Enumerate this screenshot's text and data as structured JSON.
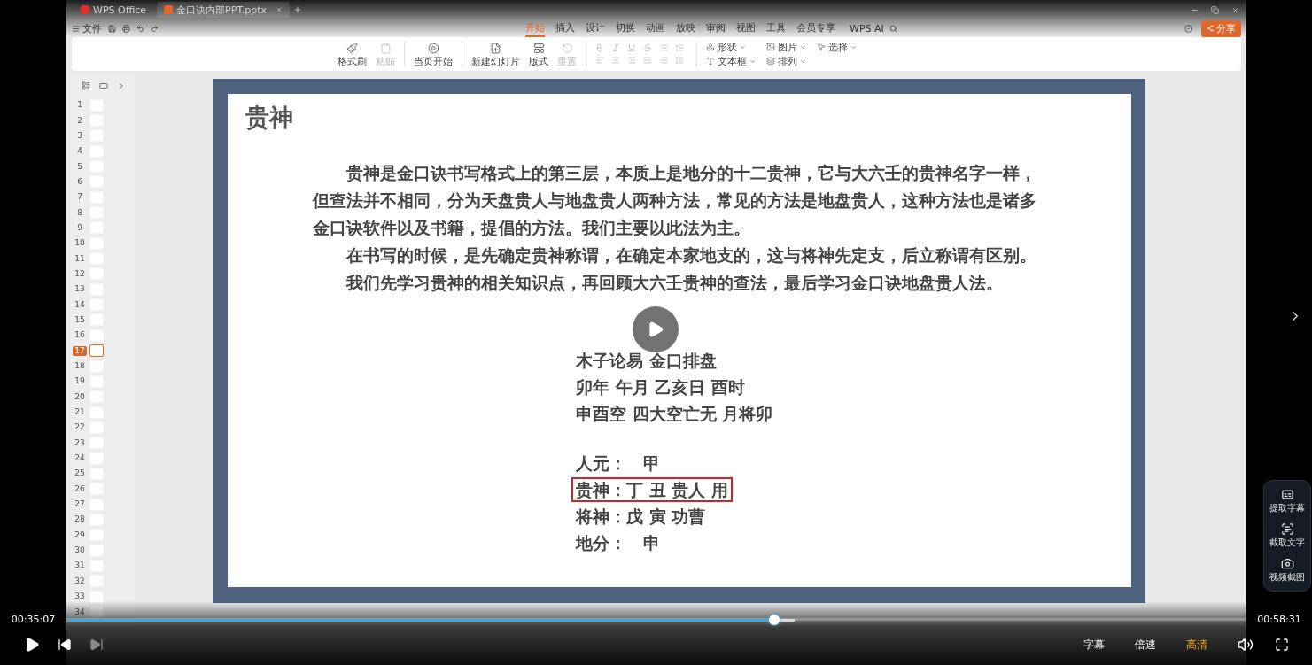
{
  "app_tabs": [
    {
      "label": "WPS Office",
      "kind": "home",
      "selected": false
    },
    {
      "label": "金口诀内部PPT.pptx",
      "kind": "doc",
      "selected": true
    }
  ],
  "menu": {
    "file": "文件",
    "tabs": [
      {
        "label": "开始",
        "selected": true
      },
      {
        "label": "插入",
        "selected": false
      },
      {
        "label": "设计",
        "selected": false
      },
      {
        "label": "切换",
        "selected": false
      },
      {
        "label": "动画",
        "selected": false
      },
      {
        "label": "放映",
        "selected": false
      },
      {
        "label": "审阅",
        "selected": false
      },
      {
        "label": "视图",
        "selected": false
      },
      {
        "label": "工具",
        "selected": false
      },
      {
        "label": "会员专享",
        "selected": false
      }
    ],
    "ai": "WPS AI",
    "share": "分享"
  },
  "ribbon": {
    "large": [
      {
        "label": "格式刷",
        "kind": "brush",
        "disabled": false
      },
      {
        "label": "粘贴",
        "kind": "paste",
        "disabled": true
      },
      {
        "label": "当页开始",
        "kind": "play",
        "disabled": false
      },
      {
        "label": "新建幻灯片",
        "kind": "new-slide",
        "disabled": false
      },
      {
        "label": "版式",
        "kind": "layout",
        "disabled": false
      },
      {
        "label": "重置",
        "kind": "reset",
        "disabled": true
      }
    ],
    "small": [
      {
        "label": "形状",
        "kind": "shapes"
      },
      {
        "label": "文本框",
        "kind": "textbox"
      },
      {
        "label": "图片",
        "kind": "image"
      },
      {
        "label": "排列",
        "kind": "arrange"
      },
      {
        "label": "选择",
        "kind": "select"
      }
    ]
  },
  "slides": [
    {
      "number": "1",
      "selected": false
    },
    {
      "number": "2",
      "selected": false
    },
    {
      "number": "3",
      "selected": false
    },
    {
      "number": "4",
      "selected": false
    },
    {
      "number": "5",
      "selected": false
    },
    {
      "number": "6",
      "selected": false
    },
    {
      "number": "7",
      "selected": false
    },
    {
      "number": "8",
      "selected": false
    },
    {
      "number": "9",
      "selected": false
    },
    {
      "number": "10",
      "selected": false
    },
    {
      "number": "11",
      "selected": false
    },
    {
      "number": "12",
      "selected": false
    },
    {
      "number": "13",
      "selected": false
    },
    {
      "number": "14",
      "selected": false
    },
    {
      "number": "15",
      "selected": false
    },
    {
      "number": "16",
      "selected": false
    },
    {
      "number": "17",
      "selected": true
    },
    {
      "number": "18",
      "selected": false
    },
    {
      "number": "19",
      "selected": false
    },
    {
      "number": "20",
      "selected": false
    },
    {
      "number": "21",
      "selected": false
    },
    {
      "number": "22",
      "selected": false
    },
    {
      "number": "23",
      "selected": false
    },
    {
      "number": "24",
      "selected": false
    },
    {
      "number": "25",
      "selected": false
    },
    {
      "number": "26",
      "selected": false
    },
    {
      "number": "27",
      "selected": false
    },
    {
      "number": "28",
      "selected": false
    },
    {
      "number": "29",
      "selected": false
    },
    {
      "number": "30",
      "selected": false
    },
    {
      "number": "31",
      "selected": false
    },
    {
      "number": "32",
      "selected": false
    },
    {
      "number": "33",
      "selected": false
    },
    {
      "number": "34",
      "selected": false
    }
  ],
  "slide": {
    "title": "贵神",
    "paragraphs": [
      "贵神是金口诀书写格式上的第三层，本质上是地分的十二贵神，它与大六壬的贵神名字一样，但查法并不相同，分为天盘贵人与地盘贵人两种方法，常见的方法是地盘贵人，这种方法也是诸多金口诀软件以及书籍，提倡的方法。我们主要以此法为主。",
      "在书写的时候，是先确定贵神称谓，在确定本家地支的，这与将神先定支，后立称谓有区别。",
      "我们先学习贵神的相关知识点，再回顾大六壬贵神的查法，最后学习金口诀地盘贵人法。"
    ],
    "info_groups": [
      [
        {
          "text": "木子论易 金口排盘",
          "highlighted": false
        },
        {
          "text": "卯年 午月 乙亥日 酉时",
          "highlighted": false
        },
        {
          "text": "申酉空 四大空亡无 月将卯",
          "highlighted": false
        }
      ],
      [
        {
          "text": "人元：　甲",
          "highlighted": false
        },
        {
          "text": "贵神：丁 丑 贵人 用",
          "highlighted": true
        },
        {
          "text": "将神：戊 寅 功曹",
          "highlighted": false
        },
        {
          "text": "地分：　申",
          "highlighted": false
        }
      ]
    ]
  },
  "player": {
    "current_time": "00:35:07",
    "total_time": "00:58:31",
    "progress": {
      "level": 0.6
    },
    "buffer": {
      "level": 0.617
    },
    "options": [
      {
        "label": "字幕",
        "selected": false
      },
      {
        "label": "倍速",
        "selected": false
      },
      {
        "label": "高清",
        "selected": true
      }
    ],
    "side_tools": [
      {
        "label": "提取字幕",
        "kind": "captions"
      },
      {
        "label": "截取文字",
        "kind": "ocr"
      },
      {
        "label": "视频截图",
        "kind": "camera"
      }
    ]
  }
}
